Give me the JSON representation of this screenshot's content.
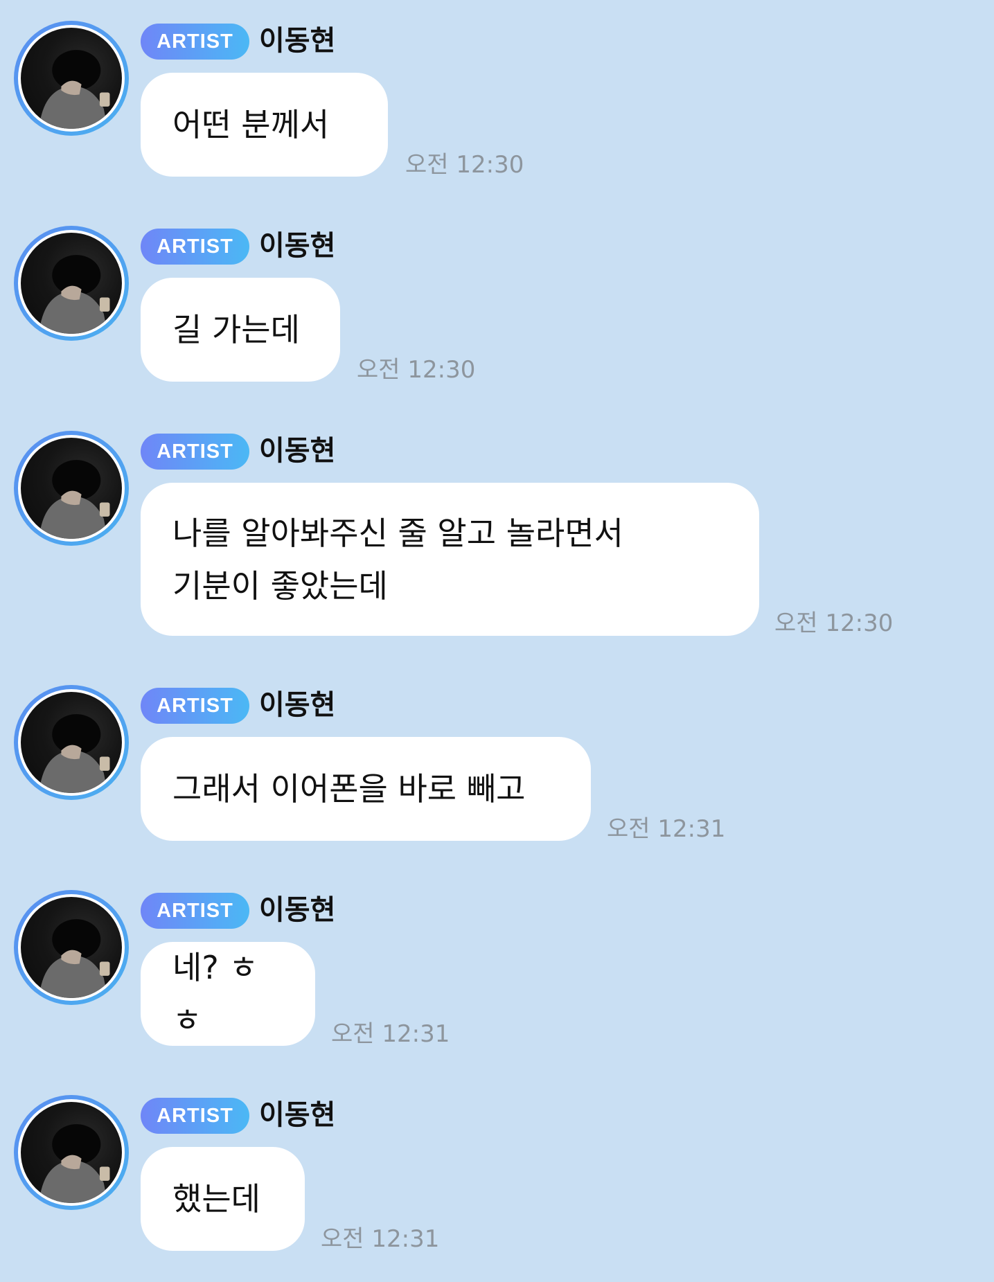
{
  "chat": {
    "messages": [
      {
        "badge": "ARTIST",
        "sender": "이동현",
        "text": "어떤 분께서",
        "time": "오전 12:30"
      },
      {
        "badge": "ARTIST",
        "sender": "이동현",
        "text": "길 가는데",
        "time": "오전 12:30"
      },
      {
        "badge": "ARTIST",
        "sender": "이동현",
        "text": "나를 알아봐주신 줄 알고 놀라면서\n기분이 좋았는데",
        "time": "오전 12:30"
      },
      {
        "badge": "ARTIST",
        "sender": "이동현",
        "text": "그래서 이어폰을 바로 빼고",
        "time": "오전 12:31"
      },
      {
        "badge": "ARTIST",
        "sender": "이동현",
        "text": "네? ㅎㅎ",
        "time": "오전 12:31"
      },
      {
        "badge": "ARTIST",
        "sender": "이동현",
        "text": "했는데",
        "time": "오전 12:31"
      }
    ]
  },
  "colors": {
    "background": "#c9dff3",
    "bubble": "#ffffff",
    "badge_start": "#6f86f7",
    "badge_end": "#4bb8f5",
    "timestamp": "#8d959d"
  }
}
